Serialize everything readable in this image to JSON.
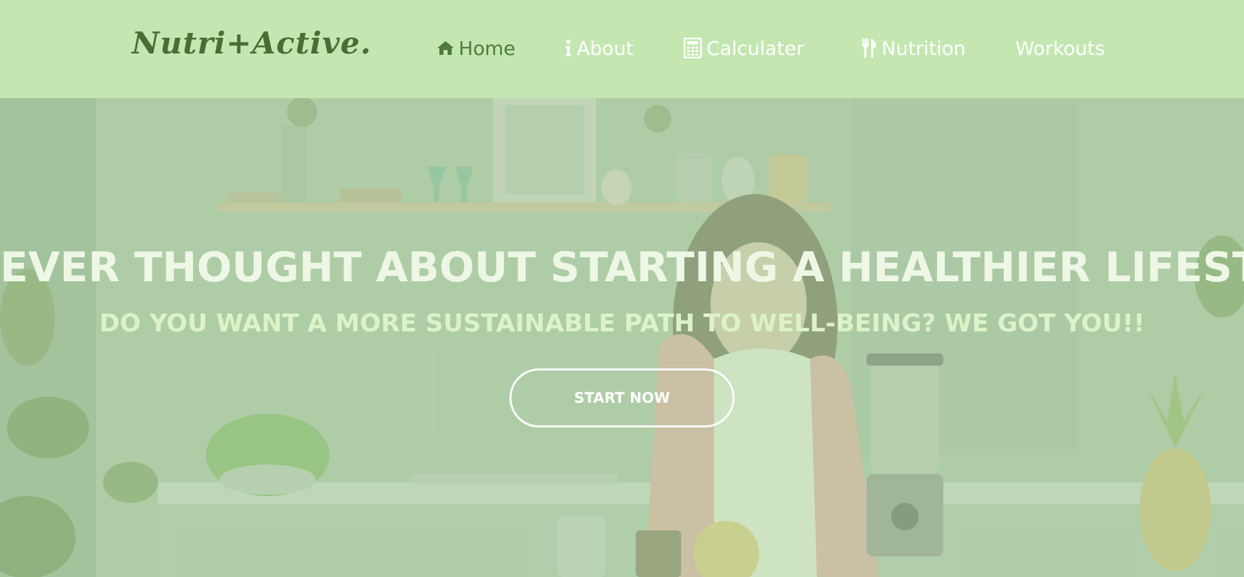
{
  "header": {
    "logo": "Nutri+Active.",
    "nav": [
      {
        "label": "Home",
        "icon": "home-icon",
        "active": true
      },
      {
        "label": "About",
        "icon": "info-icon",
        "active": false
      },
      {
        "label": "Calculater",
        "icon": "calculator-icon",
        "active": false
      },
      {
        "label": "Nutrition",
        "icon": "cutlery-icon",
        "active": false
      },
      {
        "label": "Workouts",
        "icon": "",
        "active": false
      }
    ]
  },
  "hero": {
    "title": "EVER THOUGHT ABOUT STARTING A HEALTHIER LIFESTYLE?",
    "subtitle": "DO YOU WANT A MORE SUSTAINABLE PATH TO WELL-BEING? WE GOT YOU!!",
    "cta_label": "START NOW"
  },
  "colors": {
    "header_bg": "#c4e7b1",
    "logo": "#4a6d36",
    "nav_active": "#4e7a3c",
    "nav_text": "#ffffff",
    "hero_overlay": "#b8dfa6"
  }
}
